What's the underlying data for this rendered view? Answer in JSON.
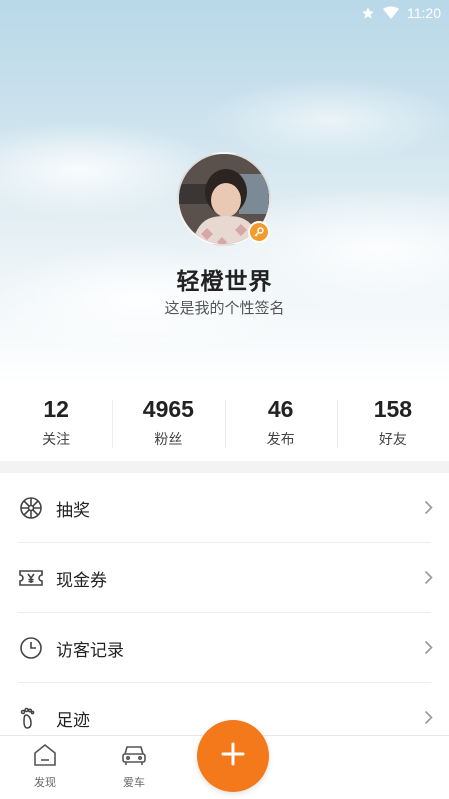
{
  "status_bar": {
    "time": "11:20",
    "icons": [
      "star-icon",
      "wifi-icon"
    ]
  },
  "profile": {
    "name": "轻橙世界",
    "signature": "这是我的个性签名"
  },
  "stats": [
    {
      "value": "12",
      "label": "关注"
    },
    {
      "value": "4965",
      "label": "粉丝"
    },
    {
      "value": "46",
      "label": "发布"
    },
    {
      "value": "158",
      "label": "好友"
    }
  ],
  "menu": [
    {
      "label": "抽奖",
      "icon": "lottery-wheel-icon"
    },
    {
      "label": "现金券",
      "icon": "coupon-icon"
    },
    {
      "label": "访客记录",
      "icon": "clock-icon"
    },
    {
      "label": "足迹",
      "icon": "footprint-icon"
    }
  ],
  "bottom_nav": [
    {
      "label": "发现",
      "icon": "discover-icon"
    },
    {
      "label": "爱车",
      "icon": "car-icon"
    }
  ],
  "colors": {
    "accent": "#f3791b",
    "badge": "#f39a2c",
    "divider": "#ececec"
  }
}
